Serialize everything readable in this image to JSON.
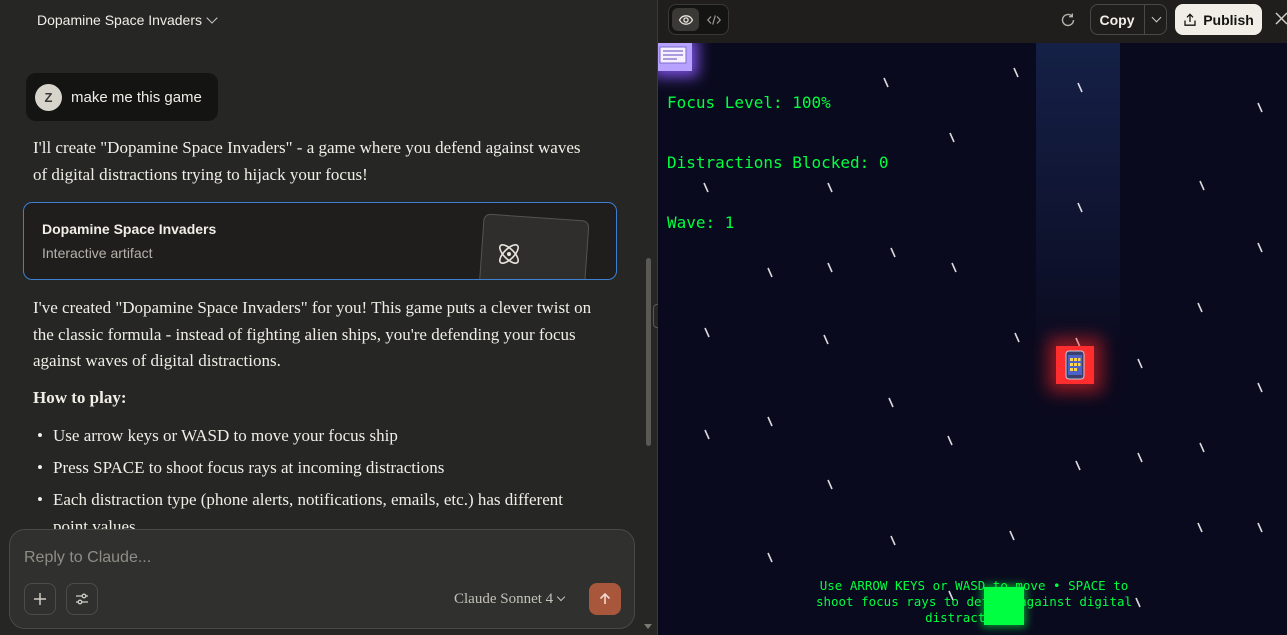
{
  "chat": {
    "title": "Dopamine Space Invaders",
    "user": {
      "initial": "Z",
      "message": "make me this game"
    },
    "intro": "I'll create \"Dopamine Space Invaders\" - a game where you defend against waves of digital distractions trying to hijack your focus!",
    "artifact": {
      "title": "Dopamine Space Invaders",
      "subtitle": "Interactive artifact",
      "icon": "atom-icon"
    },
    "body": "I've created \"Dopamine Space Invaders\" for you! This game puts a clever twist on the classic formula - instead of fighting alien ships, you're defending your focus against waves of digital distractions.",
    "howto_heading": "How to play:",
    "bullets": [
      "Use arrow keys or WASD to move your focus ship",
      "Press SPACE to shoot focus rays at incoming distractions",
      "Each distraction type (phone alerts, notifications, emails, etc.) has different point values"
    ],
    "input": {
      "placeholder": "Reply to Claude...",
      "value": ""
    },
    "model": "Claude Sonnet 4",
    "icons": {
      "plus": "plus-icon",
      "tools": "sliders-icon",
      "send": "arrow-up-icon"
    }
  },
  "toolbar": {
    "copy_label": "Copy",
    "publish_label": "Publish",
    "icons": {
      "preview": "eye-icon",
      "code": "code-icon",
      "refresh": "refresh-icon",
      "publish": "share-icon",
      "close": "close-icon"
    }
  },
  "game": {
    "hud": {
      "focus": "Focus Level: 100%",
      "blocked": "Distractions Blocked: 0",
      "wave": "Wave: 1"
    },
    "instructions": "Use ARROW KEYS or WASD to move • SPACE to shoot focus rays to defend against digital distractions!",
    "colors": {
      "background": "#0a0a1e",
      "hud": "#00ff41",
      "player": "#00ff41",
      "phone_enemy": "#ff2d2d",
      "email_enemy": "#b7a2ff"
    }
  },
  "colors": {
    "accent_blue": "#3d7fd1",
    "send": "#a9573c"
  }
}
